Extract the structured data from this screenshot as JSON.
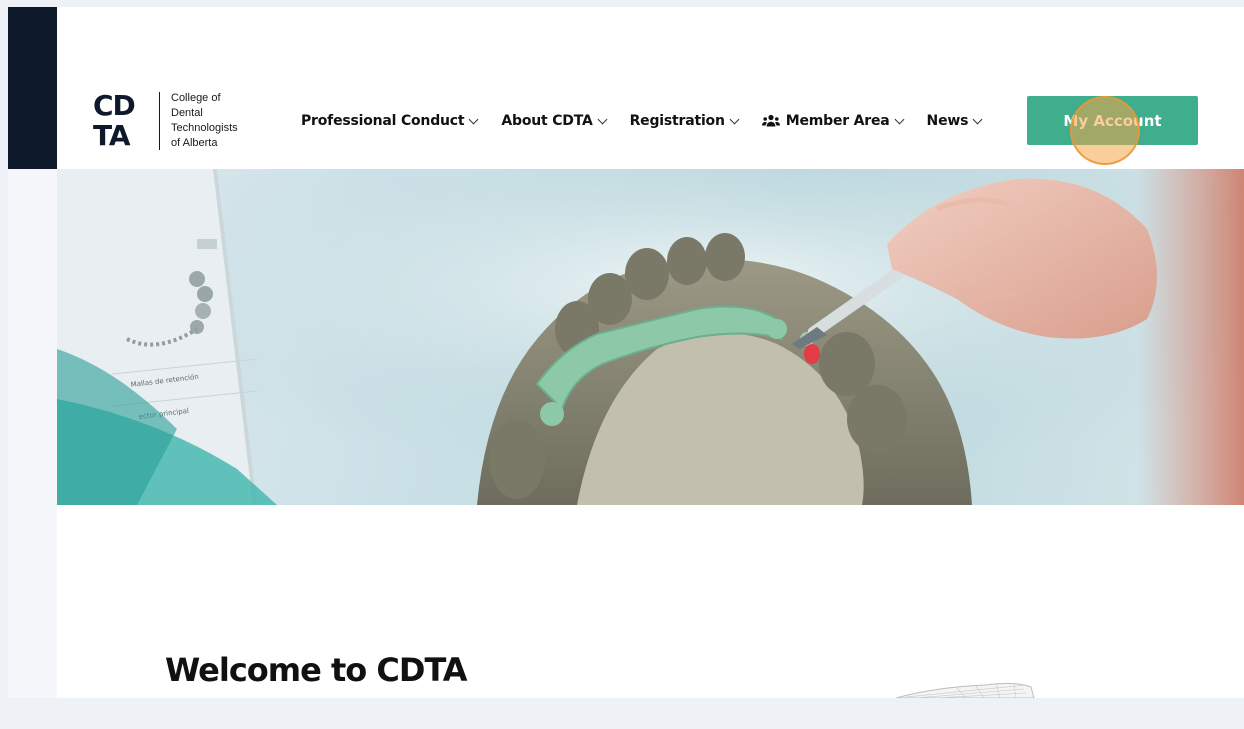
{
  "logo": {
    "mark_top": "CD",
    "mark_bottom": "TA",
    "lines": [
      "College of",
      "Dental",
      "Technologists",
      "of Alberta"
    ]
  },
  "nav": {
    "items": [
      {
        "label": "Professional Conduct"
      },
      {
        "label": "About CDTA"
      },
      {
        "label": "Registration"
      },
      {
        "label": "Member Area",
        "icon": "members-icon"
      },
      {
        "label": "News"
      }
    ]
  },
  "header": {
    "account_label": "My Account"
  },
  "hero": {
    "screen_labels": [
      "Mallas de retención",
      "ector principal"
    ],
    "image": "3D-modeled dental partial framework on a tooth model with a scalpel"
  },
  "main": {
    "heading": "Welcome to CDTA"
  },
  "colors": {
    "accent": "#3fae8d",
    "dark": "#0e1a2b",
    "highlight": "#f4a648"
  }
}
